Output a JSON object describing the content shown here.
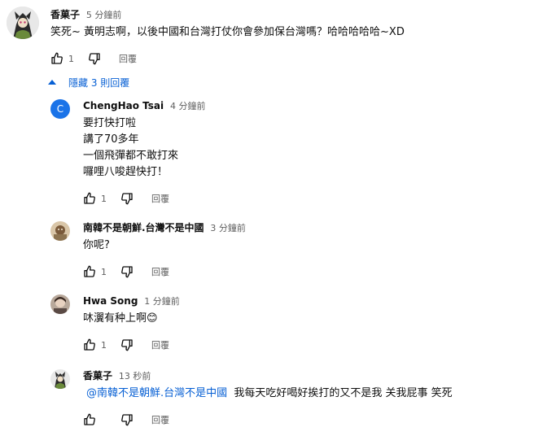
{
  "top_comment": {
    "author": "香菓子",
    "timestamp": "5 分鐘前",
    "text": "笑死~ 黃明志啊，以後中國和台灣打仗你會參加保台灣嗎？哈哈哈哈哈~XD",
    "likes": "1",
    "reply_label": "回覆"
  },
  "hide_replies_label": "隱藏 3 則回覆",
  "replies": [
    {
      "author": "ChengHao Tsai",
      "avatar_letter": "C",
      "timestamp": "4 分鐘前",
      "lines": [
        "要打快打啦",
        "講了70多年",
        "一個飛彈都不敢打來",
        "囉哩八唆趕快打！"
      ],
      "likes": "1",
      "reply_label": "回覆"
    },
    {
      "author": "南韓不是朝鮮.台灣不是中國",
      "timestamp": "3 分鐘前",
      "lines": [
        "你呢?"
      ],
      "likes": "1",
      "reply_label": "回覆"
    },
    {
      "author": "Hwa Song",
      "timestamp": "1 分鐘前",
      "lines": [
        "㕲瀷有种上啊😊"
      ],
      "likes": "1",
      "reply_label": "回覆"
    },
    {
      "author": "香菓子",
      "timestamp": "13 秒前",
      "mention": "@南韓不是朝鮮.台灣不是中國",
      "text": "  我每天吃好喝好挨打的又不是我 关我屁事 笑死",
      "likes": "",
      "reply_label": "回覆"
    }
  ],
  "icons": {
    "like": "thumbs-up-icon",
    "dislike": "thumbs-down-icon",
    "collapse": "chevron-up-icon"
  },
  "colors": {
    "link": "#065fd4",
    "secondary_text": "#606060",
    "avatar_letter_bg": "#1a73e8"
  }
}
